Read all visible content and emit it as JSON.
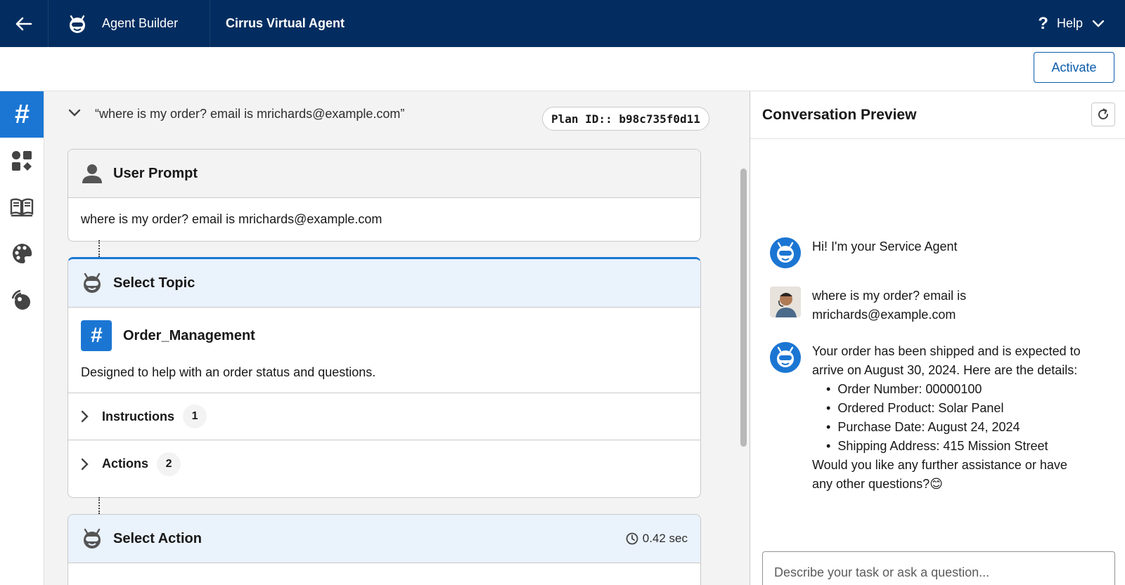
{
  "topnav": {
    "app_name": "Agent Builder",
    "agent_name": "Cirrus Virtual Agent",
    "help_label": "Help"
  },
  "subbar": {
    "activate_label": "Activate"
  },
  "rail": {
    "items": [
      "topic-icon",
      "components-icon",
      "library-icon",
      "theme-icon",
      "connection-icon"
    ],
    "active": "topic-icon"
  },
  "canvas": {
    "utterance": "“where is my order? email is mrichards@example.com”",
    "plan_id": "Plan ID:: b98c735f0d11",
    "user_prompt": {
      "title": "User Prompt",
      "body": "where is my order? email is mrichards@example.com"
    },
    "select_topic": {
      "title": "Select Topic",
      "topic_name": "Order_Management",
      "description": "Designed to help with an order status and questions.",
      "instructions_label": "Instructions",
      "instructions_count": "1",
      "actions_label": "Actions",
      "actions_count": "2"
    },
    "select_action": {
      "title": "Select Action",
      "timing": "0.42 sec"
    }
  },
  "preview": {
    "title": "Conversation Preview",
    "messages": {
      "greeting": "Hi! I'm your Service Agent",
      "user_line1": "where is my order? email is",
      "user_line2": "mrichards@example.com",
      "reply_intro1": "Your order has been shipped and is expected to",
      "reply_intro2": "arrive on August 30, 2024. Here are the details:",
      "detail1": "Order Number: 00000100",
      "detail2": "Ordered Product: Solar Panel",
      "detail3": "Purchase Date: August 24, 2024",
      "detail4": "Shipping Address: 415 Mission Street",
      "reply_outro1": "Would you like any further assistance or have",
      "reply_outro2": "any other questions?😊"
    },
    "composer_placeholder": "Describe your task or ask a question..."
  },
  "colors": {
    "nav_bg": "#032d60",
    "accent": "#1b76d3",
    "brand_blue": "#0b5cab"
  }
}
